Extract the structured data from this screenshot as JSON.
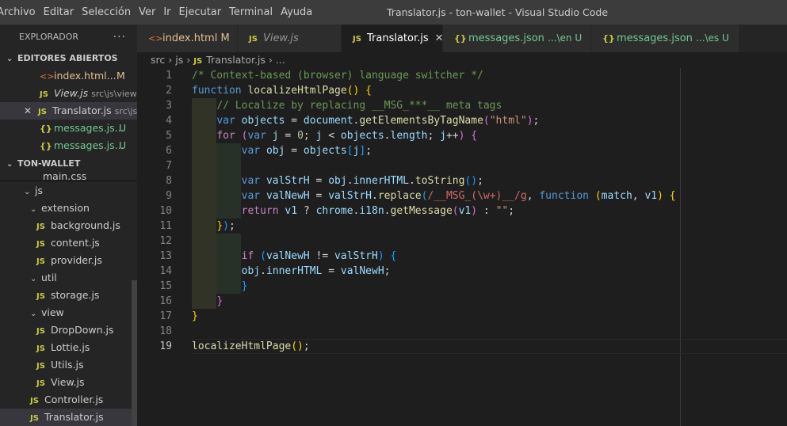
{
  "menu": [
    "Archivo",
    "Editar",
    "Selección",
    "Ver",
    "Ir",
    "Ejecutar",
    "Terminal",
    "Ayuda"
  ],
  "window_title": "Translator.js - ton-wallet - Visual Studio Code",
  "explorer": {
    "title": "EXPLORADOR",
    "open_editors_title": "EDITORES ABIERTOS",
    "open_editors": [
      {
        "icon": "<>",
        "name": "index.html...",
        "hint": "",
        "status": "M"
      },
      {
        "icon": "JS",
        "name": "View.js",
        "hint": "src\\js\\view",
        "status": ""
      },
      {
        "icon": "JS",
        "name": "Translator.js",
        "hint": "src\\js",
        "status": ""
      },
      {
        "icon": "{}",
        "name": "messages.js...",
        "hint": "",
        "status": "U"
      },
      {
        "icon": "{}",
        "name": "messages.js...",
        "hint": "",
        "status": "U"
      }
    ],
    "project_title": "TON-WALLET",
    "tree": {
      "main_css": "main.css",
      "js": "js",
      "extension": "extension",
      "background": "background.js",
      "content": "content.js",
      "provider": "provider.js",
      "util": "util",
      "storage": "storage.js",
      "view": "view",
      "dropdown": "DropDown.js",
      "lottie": "Lottie.js",
      "utils": "Utils.js",
      "viewjs": "View.js",
      "controller": "Controller.js",
      "translator": "Translator.js"
    }
  },
  "tabs": [
    {
      "icon": "<>",
      "label": "index.html",
      "badge": "M"
    },
    {
      "icon": "JS",
      "label": "View.js",
      "badge": ""
    },
    {
      "icon": "JS",
      "label": "Translator.js",
      "badge": ""
    },
    {
      "icon": "{}",
      "label": "messages.json",
      "badge": "...\\en U"
    },
    {
      "icon": "{}",
      "label": "messages.json",
      "badge": "...\\es U"
    }
  ],
  "breadcrumb": {
    "seg1": "src",
    "seg2": "js",
    "icon": "JS",
    "seg3": "Translator.js",
    "seg4": "..."
  },
  "line_numbers": [
    "1",
    "2",
    "3",
    "4",
    "5",
    "6",
    "7",
    "8",
    "9",
    "10",
    "11",
    "12",
    "13",
    "14",
    "15",
    "16",
    "17",
    "18",
    "19"
  ],
  "colors": {
    "keyword": "#569cd6",
    "function": "#dcdcaa",
    "variable": "#9cdcfe",
    "string": "#ce9178",
    "comment": "#6a9955",
    "js_icon": "#cbcb41",
    "html_icon": "#e37933"
  },
  "code": {
    "l1": "/* Context-based (browser) language switcher */",
    "l3": "// Localize by replacing __MSG_***__ meta tags"
  }
}
